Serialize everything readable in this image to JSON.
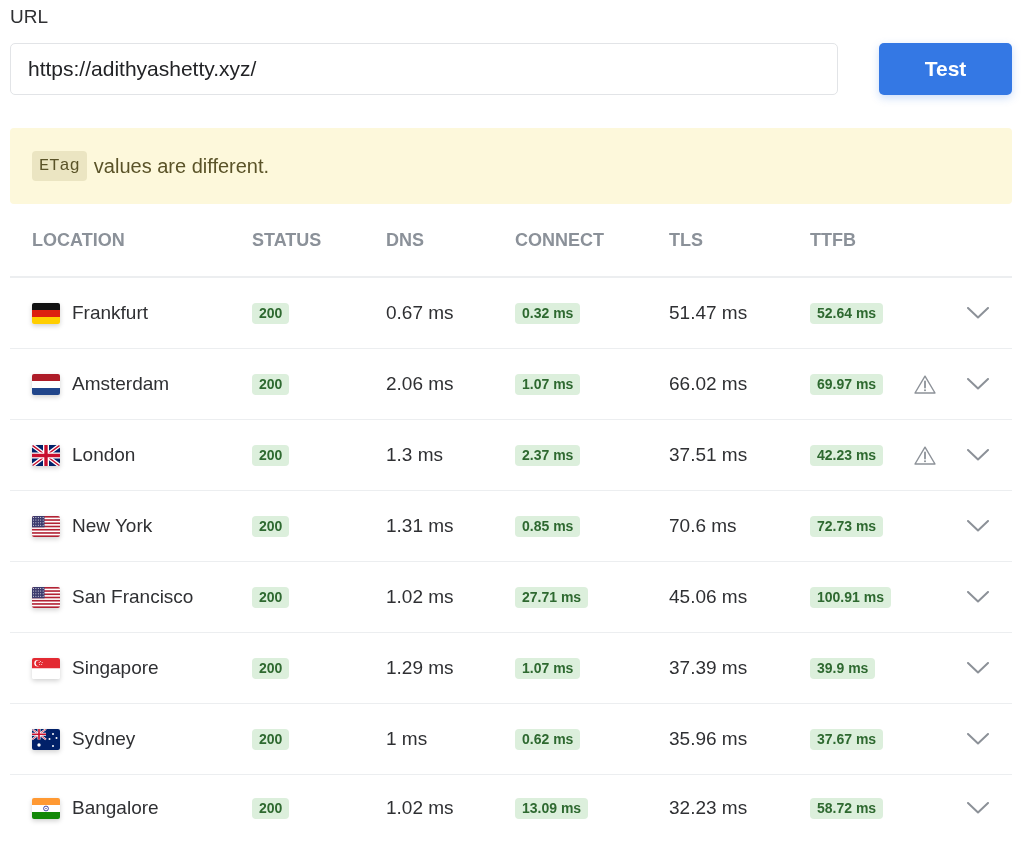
{
  "url_field": {
    "label": "URL",
    "value": "https://adithyashetty.xyz/"
  },
  "test_button": {
    "label": "Test"
  },
  "alert": {
    "code": "ETag",
    "text": "values are different."
  },
  "table": {
    "columns": [
      "LOCATION",
      "STATUS",
      "DNS",
      "CONNECT",
      "TLS",
      "TTFB"
    ],
    "rows": [
      {
        "kind": "de",
        "location": "Frankfurt",
        "status": "200",
        "dns": "0.67 ms",
        "connect": "0.32 ms",
        "tls": "51.47 ms",
        "ttfb": "52.64 ms",
        "warning": false,
        "expanded": false
      },
      {
        "kind": "nl",
        "location": "Amsterdam",
        "status": "200",
        "dns": "2.06 ms",
        "connect": "1.07 ms",
        "tls": "66.02 ms",
        "ttfb": "69.97 ms",
        "warning": true,
        "expanded": false
      },
      {
        "kind": "gb",
        "location": "London",
        "status": "200",
        "dns": "1.3 ms",
        "connect": "2.37 ms",
        "tls": "37.51 ms",
        "ttfb": "42.23 ms",
        "warning": true,
        "expanded": false
      },
      {
        "kind": "us",
        "location": "New York",
        "status": "200",
        "dns": "1.31 ms",
        "connect": "0.85 ms",
        "tls": "70.6 ms",
        "ttfb": "72.73 ms",
        "warning": false,
        "expanded": false
      },
      {
        "kind": "us",
        "location": "San Francisco",
        "status": "200",
        "dns": "1.02 ms",
        "connect": "27.71 ms",
        "tls": "45.06 ms",
        "ttfb": "100.91 ms",
        "warning": false,
        "expanded": false
      },
      {
        "kind": "sg",
        "location": "Singapore",
        "status": "200",
        "dns": "1.29 ms",
        "connect": "1.07 ms",
        "tls": "37.39 ms",
        "ttfb": "39.9 ms",
        "warning": false,
        "expanded": false
      },
      {
        "kind": "au",
        "location": "Sydney",
        "status": "200",
        "dns": "1 ms",
        "connect": "0.62 ms",
        "tls": "35.96 ms",
        "ttfb": "37.67 ms",
        "warning": false,
        "expanded": false
      },
      {
        "kind": "in",
        "location": "Bangalore",
        "status": "200",
        "dns": "1.02 ms",
        "connect": "13.09 ms",
        "tls": "32.23 ms",
        "ttfb": "58.72 ms",
        "warning": false,
        "expanded": false
      }
    ]
  }
}
